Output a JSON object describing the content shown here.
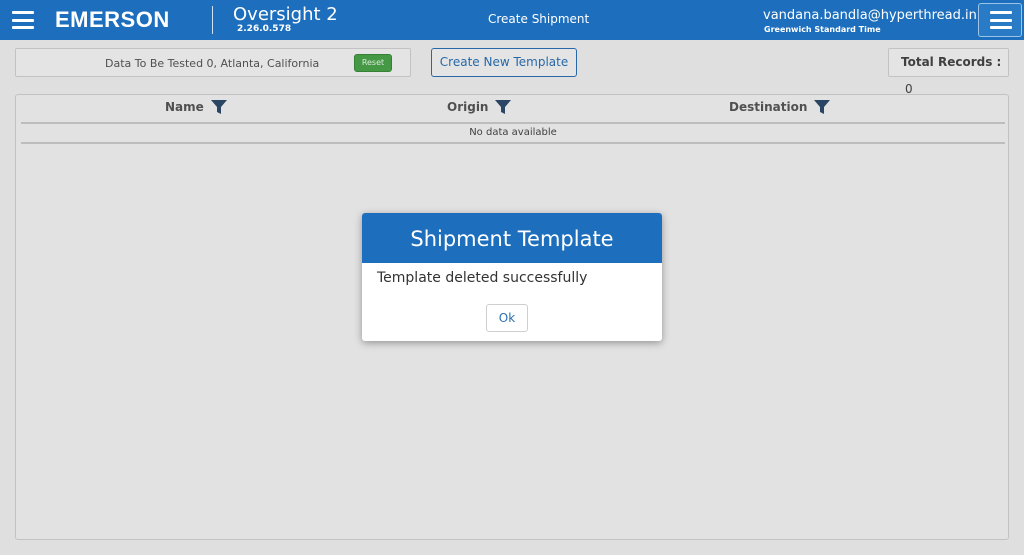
{
  "header": {
    "brand": "EMERSON",
    "app_name": "Oversight 2",
    "app_version": "2.26.0.578",
    "page_title": "Create Shipment",
    "user_email": "vandana.bandla@hyperthread.in",
    "timezone": "Greenwich Standard Time"
  },
  "toolbar": {
    "filter_text": "Data To Be Tested 0, Atlanta, California",
    "reset_label": "Reset",
    "create_label": "Create New Template",
    "total_label": "Total Records :",
    "total_value": "0"
  },
  "grid": {
    "columns": [
      "Name",
      "Origin",
      "Destination"
    ],
    "empty_text": "No data available"
  },
  "modal": {
    "title": "Shipment Template",
    "message": "Template deleted successfully",
    "ok_label": "Ok"
  },
  "colors": {
    "primary": "#1d6fbd",
    "reset_green": "#4aa34a"
  }
}
